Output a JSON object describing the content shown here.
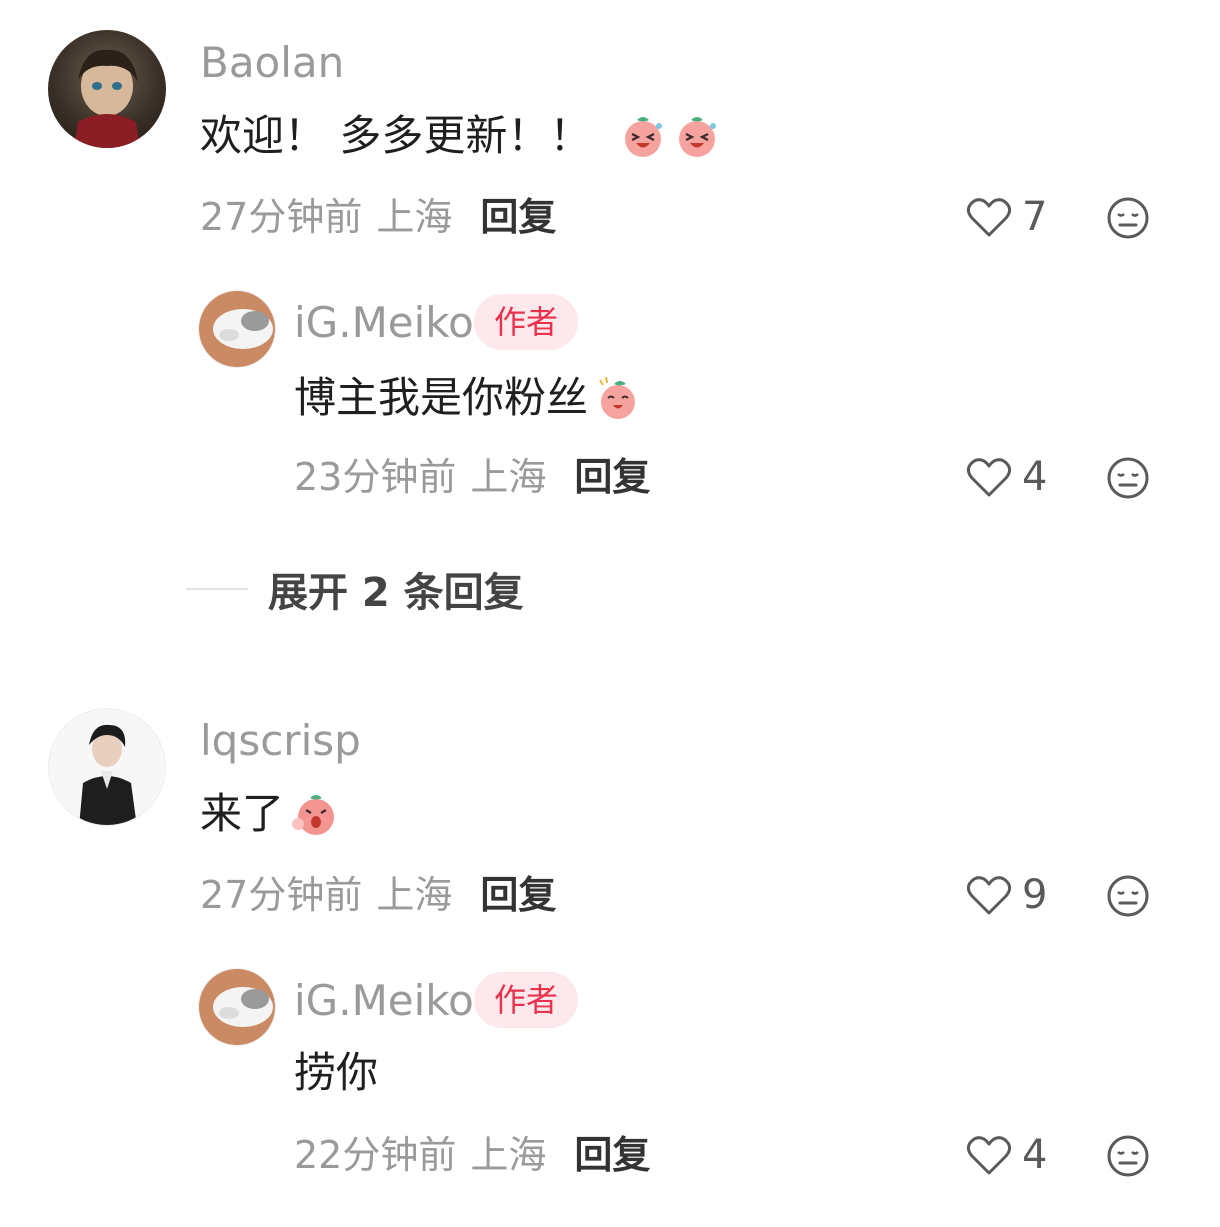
{
  "comments": [
    {
      "username": "Baolan",
      "text": "欢迎！ 多多更新！！",
      "emojis": [
        "laughing-peach-emoji",
        "laughing-peach-emoji"
      ],
      "time": "27分钟前",
      "location": "上海",
      "reply_label": "回复",
      "likes": "7",
      "replies": [
        {
          "username": "iG.Meiko",
          "badge": "作者",
          "text": "博主我是你粉丝",
          "emojis": [
            "shy-peach-emoji"
          ],
          "time": "23分钟前",
          "location": "上海",
          "reply_label": "回复",
          "likes": "4"
        }
      ],
      "expand_label": "展开 2 条回复"
    },
    {
      "username": "lqscrisp",
      "text": "来了",
      "emojis": [
        "surprised-peach-emoji"
      ],
      "time": "27分钟前",
      "location": "上海",
      "reply_label": "回复",
      "likes": "9",
      "replies": [
        {
          "username": "iG.Meiko",
          "badge": "作者",
          "text": "捞你",
          "emojis": [],
          "time": "22分钟前",
          "location": "上海",
          "reply_label": "回复",
          "likes": "4"
        }
      ]
    }
  ],
  "icons": {
    "like": "heart-outline-icon",
    "dislike": "neutral-face-icon"
  },
  "colors": {
    "badge_bg": "#fde8ec",
    "badge_text": "#e8334f",
    "meta_text": "#9a9a9a"
  }
}
